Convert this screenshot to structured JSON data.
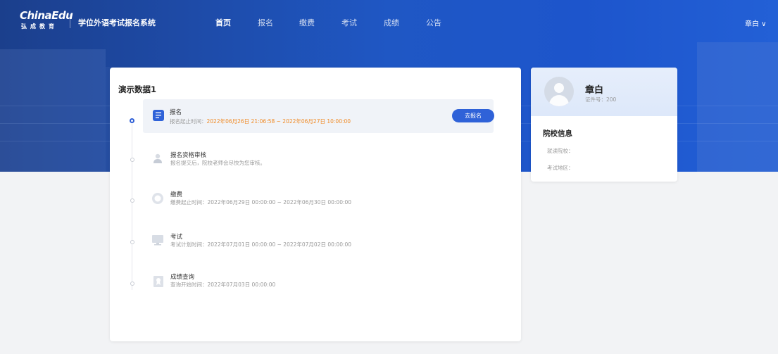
{
  "header": {
    "logo_text": "ChinaEdu",
    "logo_sub": "弘成教育",
    "system_title": "学位外语考试报名系统",
    "nav": [
      {
        "label": "首页",
        "active": true
      },
      {
        "label": "报名",
        "active": false
      },
      {
        "label": "缴费",
        "active": false
      },
      {
        "label": "考试",
        "active": false
      },
      {
        "label": "成绩",
        "active": false
      },
      {
        "label": "公告",
        "active": false
      }
    ],
    "user_label": "章白 ∨"
  },
  "main": {
    "title": "演示数据1",
    "steps": [
      {
        "name": "报名",
        "desc_prefix": "报名起止时间：",
        "desc_time": "2022年06月26日 21:06:58 ~ 2022年06月27日 10:00:00",
        "button": "去报名",
        "current": true,
        "icon": "document-icon"
      },
      {
        "name": "报名资格审核",
        "desc_prefix": "报名提交后，院校老师会尽快为您审核。",
        "desc_time": "",
        "current": false,
        "icon": "user-check-icon"
      },
      {
        "name": "缴费",
        "desc_prefix": "缴费起止时间：",
        "desc_time": "2022年06月29日 00:00:00 ~ 2022年06月30日 00:00:00",
        "current": false,
        "icon": "coin-icon"
      },
      {
        "name": "考试",
        "desc_prefix": "考试计划时间：",
        "desc_time": "2022年07月01日 00:00:00 ~ 2022年07月02日 00:00:00",
        "current": false,
        "icon": "monitor-icon"
      },
      {
        "name": "成绩查询",
        "desc_prefix": "查询开始时间：",
        "desc_time": "2022年07月03日 00:00:00",
        "current": false,
        "icon": "certificate-icon"
      }
    ]
  },
  "profile": {
    "name": "章白",
    "cert_no": "证件号：200",
    "school_section_title": "院校信息",
    "school_label": "就读院校：",
    "region_label": "考试地区："
  },
  "colors": {
    "primary": "#2f62d8",
    "highlight": "#f08a24",
    "hero": "#1f57c4"
  }
}
